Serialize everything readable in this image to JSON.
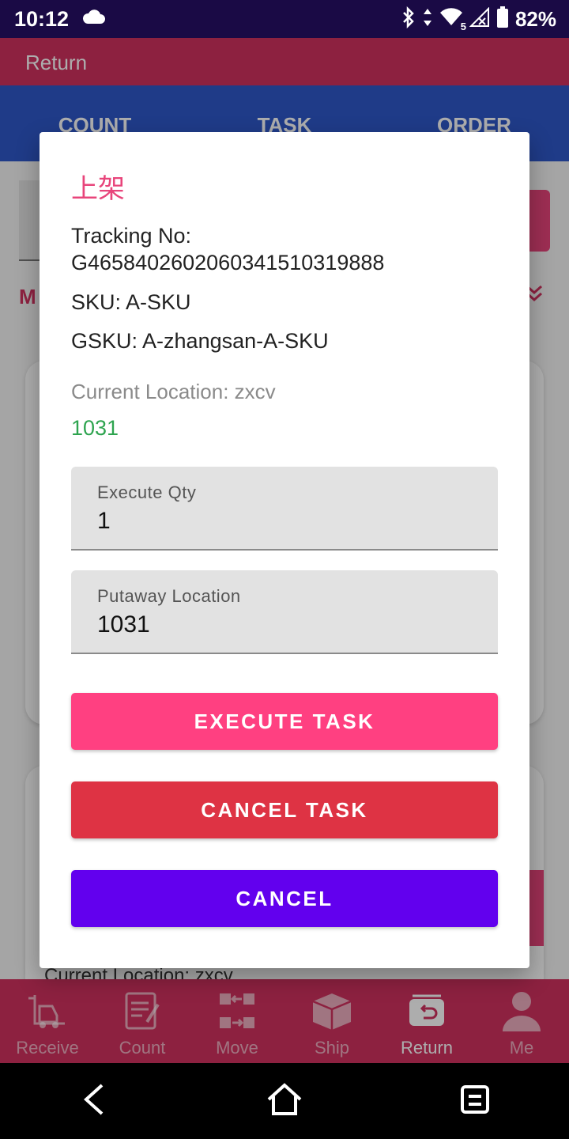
{
  "status_bar": {
    "time": "10:12",
    "battery": "82%",
    "network_badge": "5"
  },
  "app": {
    "title": "Return",
    "tabs": [
      {
        "label": "COUNT"
      },
      {
        "label": "TASK"
      },
      {
        "label": "ORDER"
      }
    ],
    "filter_label": "M",
    "card2_text": "Current Location: zxcv",
    "bottom_nav": [
      {
        "label": "Receive",
        "icon": "forklift-icon"
      },
      {
        "label": "Count",
        "icon": "clipboard-icon"
      },
      {
        "label": "Move",
        "icon": "move-arrows-icon"
      },
      {
        "label": "Ship",
        "icon": "box-icon"
      },
      {
        "label": "Return",
        "icon": "return-tray-icon",
        "active": true
      },
      {
        "label": "Me",
        "icon": "person-icon"
      }
    ]
  },
  "dialog": {
    "title": "上架",
    "tracking": "Tracking No: G465840260206034151031988 8",
    "tracking_full": "Tracking No: G4658402602060341510319888",
    "sku": "SKU: A-SKU",
    "gsku": "GSKU: A-zhangsan-A-SKU",
    "current_location": "Current Location: zxcv",
    "location_code": "1031",
    "fields": {
      "execute_qty": {
        "label": "Execute Qty",
        "value": "1"
      },
      "putaway_location": {
        "label": "Putaway Location",
        "value": "1031"
      }
    },
    "buttons": {
      "execute": "EXECUTE TASK",
      "cancel_task": "CANCEL TASK",
      "cancel": "CANCEL"
    }
  },
  "colors": {
    "accent_pink": "#ff4081",
    "danger_red": "#de3344",
    "primary_purple": "#6200ee",
    "success_green": "#2ea44f"
  }
}
